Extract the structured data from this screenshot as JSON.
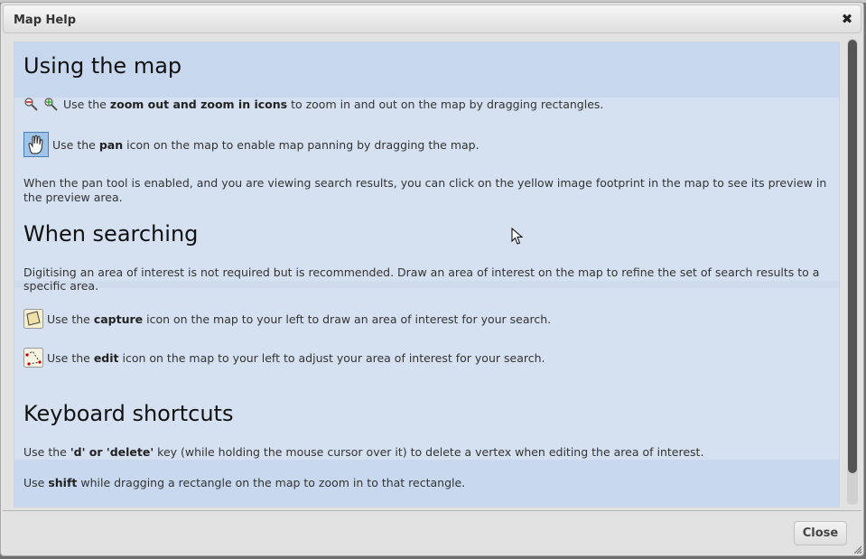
{
  "dialog": {
    "title": "Map Help",
    "close_button_label": "Close"
  },
  "sections": {
    "using_map": {
      "heading": "Using the map",
      "zoom_line_prefix": "Use the ",
      "zoom_line_bold": "zoom out and zoom in icons",
      "zoom_line_suffix": " to zoom in and out on the map by dragging rectangles.",
      "pan_line_prefix": "Use the ",
      "pan_line_bold": "pan",
      "pan_line_suffix": " icon on the map to enable map panning by dragging the map.",
      "pan_note": "When the pan tool is enabled, and you are viewing search results, you can click on the yellow image footprint in the map to see its preview in the preview area."
    },
    "searching": {
      "heading": "When searching",
      "intro": "Digitising an area of interest is not required but is recommended. Draw an area of interest on the map to refine the set of search results to a specific area.",
      "capture_prefix": "Use the ",
      "capture_bold": "capture",
      "capture_suffix": " icon on the map to your left to draw an area of interest for your search.",
      "edit_prefix": "Use the ",
      "edit_bold": "edit",
      "edit_suffix": " icon on the map to your left to adjust your area of interest for your search."
    },
    "shortcuts": {
      "heading": "Keyboard shortcuts",
      "delete_prefix": "Use the ",
      "delete_bold": "'d' or 'delete'",
      "delete_suffix": " key (while holding the mouse cursor over it) to delete a vertex when editing the area of interest.",
      "shift_prefix": "Use ",
      "shift_bold": "shift",
      "shift_suffix": " while dragging a rectangle on the map to zoom in to that rectangle."
    }
  },
  "icons": {
    "zoom_out": "zoom-out-icon",
    "zoom_in": "zoom-in-icon",
    "pan": "hand-icon",
    "capture": "capture-polygon-icon",
    "edit": "edit-vertex-icon",
    "close": "close-icon"
  },
  "colors": {
    "content_bg": "#d5e1f1",
    "band_bg": "#c7d8ee",
    "title_bg": "#e6e6e6"
  }
}
